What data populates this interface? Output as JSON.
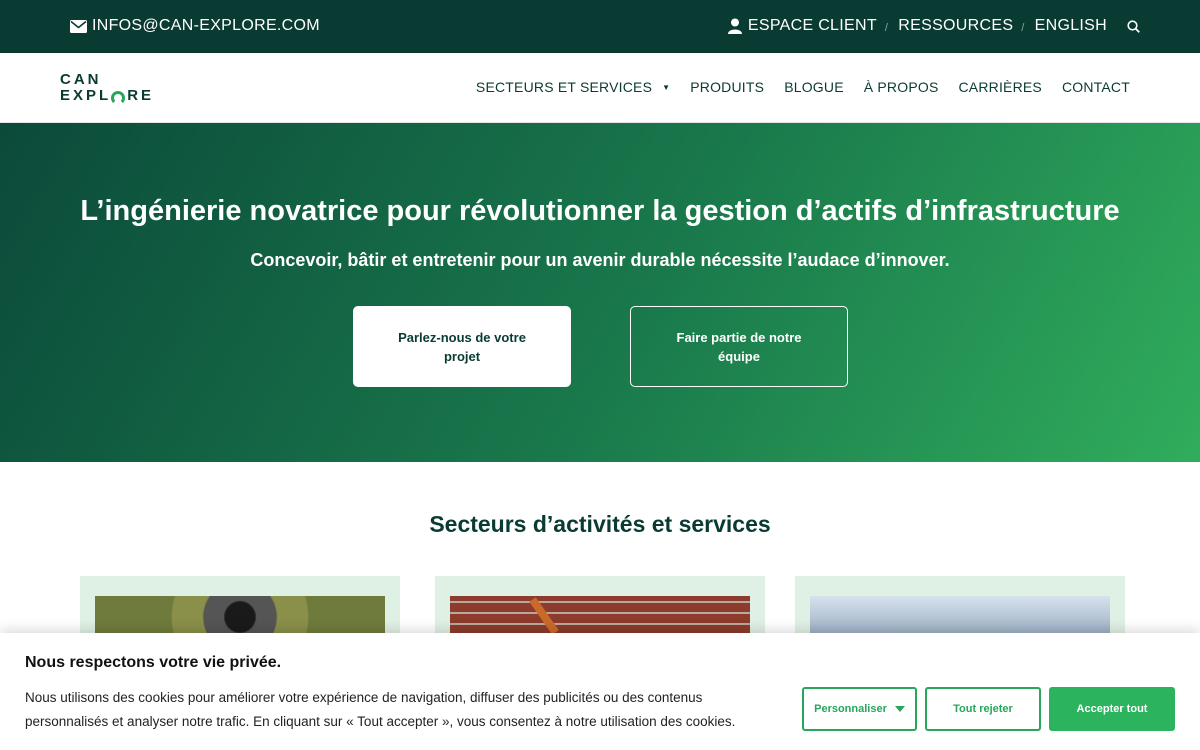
{
  "topbar": {
    "email": "INFOS@CAN-EXPLORE.COM",
    "links": [
      "ESPACE CLIENT",
      "RESSOURCES",
      "ENGLISH"
    ],
    "separator": "/"
  },
  "logo": {
    "line1": "CAN",
    "line2_a": "EXPL",
    "line2_b": "RE"
  },
  "nav": {
    "items": [
      "SECTEURS ET SERVICES",
      "PRODUITS",
      "BLOGUE",
      "À PROPOS",
      "CARRIÈRES",
      "CONTACT"
    ],
    "caret": "▼"
  },
  "hero": {
    "title": "L’ingénierie novatrice pour révolutionner la gestion d’actifs d’infrastructure",
    "subtitle": "Concevoir, bâtir et entretenir pour un avenir durable nécessite l’audace d’innover.",
    "primary_button": "Parlez-nous de votre projet",
    "secondary_button": "Faire partie de notre équipe"
  },
  "sectors": {
    "title": "Secteurs d’activités et services"
  },
  "cookie": {
    "title": "Nous respectons votre vie privée.",
    "text": "Nous utilisons des cookies pour améliorer votre expérience de navigation, diffuser des publicités ou des contenus personnalisés et analyser notre trafic. En cliquant sur « Tout accepter », vous consentez à notre utilisation des cookies.",
    "customize": "Personnaliser",
    "reject": "Tout rejeter",
    "accept": "Accepter tout"
  },
  "colors": {
    "brand_dark": "#0a3b33",
    "brand_green": "#2aa55c"
  },
  "icons": [
    "envelope-icon",
    "user-icon",
    "search-icon",
    "caret-down-icon"
  ]
}
